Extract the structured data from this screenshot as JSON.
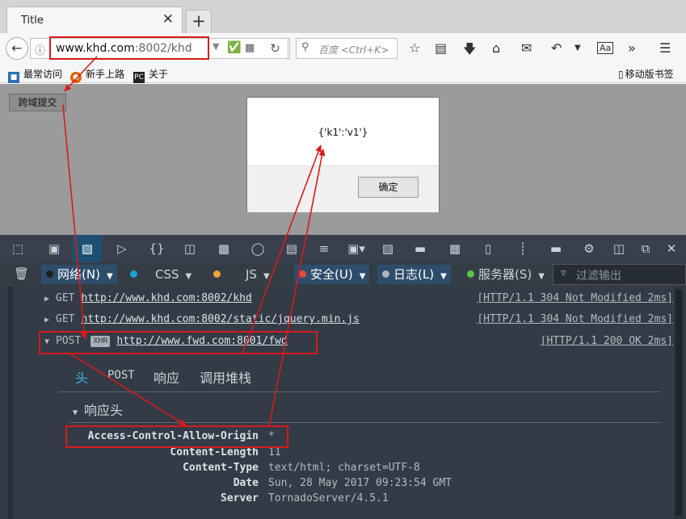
{
  "browser": {
    "tab_title": "Title",
    "tab_close": "✕",
    "new_tab": "+",
    "url_host": "www.khd.com",
    "url_rest": ":8002/khd",
    "search_placeholder": "百度 <Ctrl+K>"
  },
  "bookmarks": [
    {
      "label": "最常访问",
      "icon": "bookmark-icon",
      "color": "#2f6fb3"
    },
    {
      "label": "新手上路",
      "icon": "firefox-icon",
      "color": "#e66000"
    },
    {
      "label": "关于",
      "icon": "pc-icon",
      "color": "#222222"
    }
  ],
  "mobile_bookmarks": "移动版书签",
  "page": {
    "cross_domain_button": "跨域提交",
    "dialog_message": "{'k1':'v1'}",
    "dialog_ok": "确定"
  },
  "devtools": {
    "filters": [
      {
        "label": "网络(N)",
        "dot": "#1f1f1f",
        "on": true,
        "arrow": true
      },
      {
        "label": "",
        "dot": "#1ba1d9",
        "on": false,
        "arrow": false
      },
      {
        "label": "CSS",
        "dot": "",
        "on": false,
        "arrow": true
      },
      {
        "label": "",
        "dot": "#f0a33a",
        "on": false,
        "arrow": false
      },
      {
        "label": "JS",
        "dot": "",
        "on": false,
        "arrow": true
      },
      {
        "label": "安全(U)",
        "dot": "#e84c3d",
        "on": true,
        "arrow": true
      },
      {
        "label": "日志(L)",
        "dot": "#aeb4ba",
        "on": true,
        "arrow": true
      },
      {
        "label": "服务器(S)",
        "dot": "#58c44b",
        "on": false,
        "arrow": true
      }
    ],
    "filter_placeholder": "过滤输出",
    "requests": [
      {
        "method": "GET",
        "url": "http://www.khd.com:8002/khd",
        "status": "[HTTP/1.1 304 Not Modified 2ms]",
        "xhr": ""
      },
      {
        "method": "GET",
        "url": "http://www.khd.com:8002/static/jquery.min.js",
        "status": "[HTTP/1.1 304 Not Modified 2ms]",
        "xhr": ""
      },
      {
        "method": "POST",
        "url": "http://www.fwd.com:8001/fwd",
        "status": "[HTTP/1.1 200 OK 2ms]",
        "xhr": "XHR"
      }
    ],
    "detail_tabs": [
      "头",
      "POST",
      "响应",
      "调用堆栈"
    ],
    "response_headers_title": "响应头",
    "headers": [
      {
        "name": "Access-Control-Allow-Origin",
        "value": "*"
      },
      {
        "name": "Content-Length",
        "value": "11"
      },
      {
        "name": "Content-Type",
        "value": "text/html; charset=UTF-8"
      },
      {
        "name": "Date",
        "value": "Sun, 28 May 2017 09:23:54 GMT"
      },
      {
        "name": "Server",
        "value": "TornadoServer/4.5.1"
      }
    ]
  }
}
